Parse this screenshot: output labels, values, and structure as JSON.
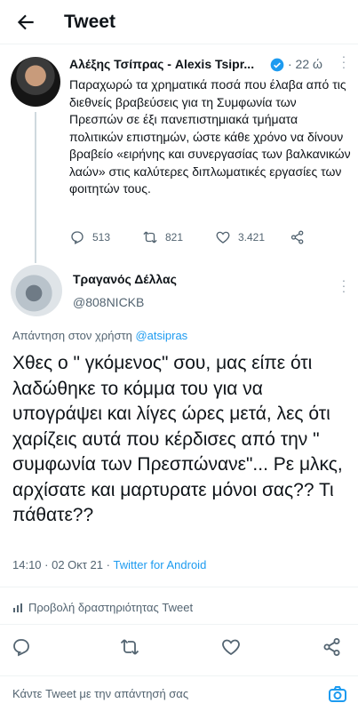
{
  "header": {
    "title": "Tweet",
    "back_icon": "arrow-left-icon"
  },
  "tweet1": {
    "name": "Αλέξης Τσίπρας - Alexis Tsipr...",
    "time": "· 22 ώ",
    "text": "Παραχωρώ τα χρηματικά ποσά που έλαβα από τις διεθνείς βραβεύσεις για τη Συμφωνία των Πρεσπών σε έξι πανεπιστημιακά τμήματα πολιτικών επιστημών, ώστε κάθε χρόνο να δίνουν βραβείο «ειρήνης και συνεργασίας των βαλκανικών λαών» στις καλύτερες διπλωματικές εργασίες των φοιτητών τους.",
    "replies": "513",
    "retweets": "821",
    "likes": "3.421"
  },
  "tweet2": {
    "name": "Τραγανός Δέλλας",
    "handle": "@808NICKB",
    "replying_prefix": "Απάντηση στον χρήστη ",
    "replying_mention": "@atsipras",
    "text": "Χθες ο \" γκόμενος\" σου, μας είπε ότι λαδώθηκε το κόμμα του για να υπογράψει και λίγες ώρες μετά, λες ότι χαρίζεις  αυτά που κέρδισες από την \" συμφωνία των Πρεσπώνανε\"... Ρε μλκς, αρχίσατε και μαρτυρατε μόνοι σας?? Τι πάθατε??",
    "timestamp": "14:10 · 02 Οκτ 21 · ",
    "source": "Twitter for Android",
    "activity": "Προβολή δραστηριότητας Tweet"
  },
  "reply_bar": {
    "placeholder": "Κάντε Tweet με την απάντησή σας"
  },
  "colors": {
    "accent": "#1d9bf0",
    "text": "#0f1419",
    "muted": "#536471"
  }
}
